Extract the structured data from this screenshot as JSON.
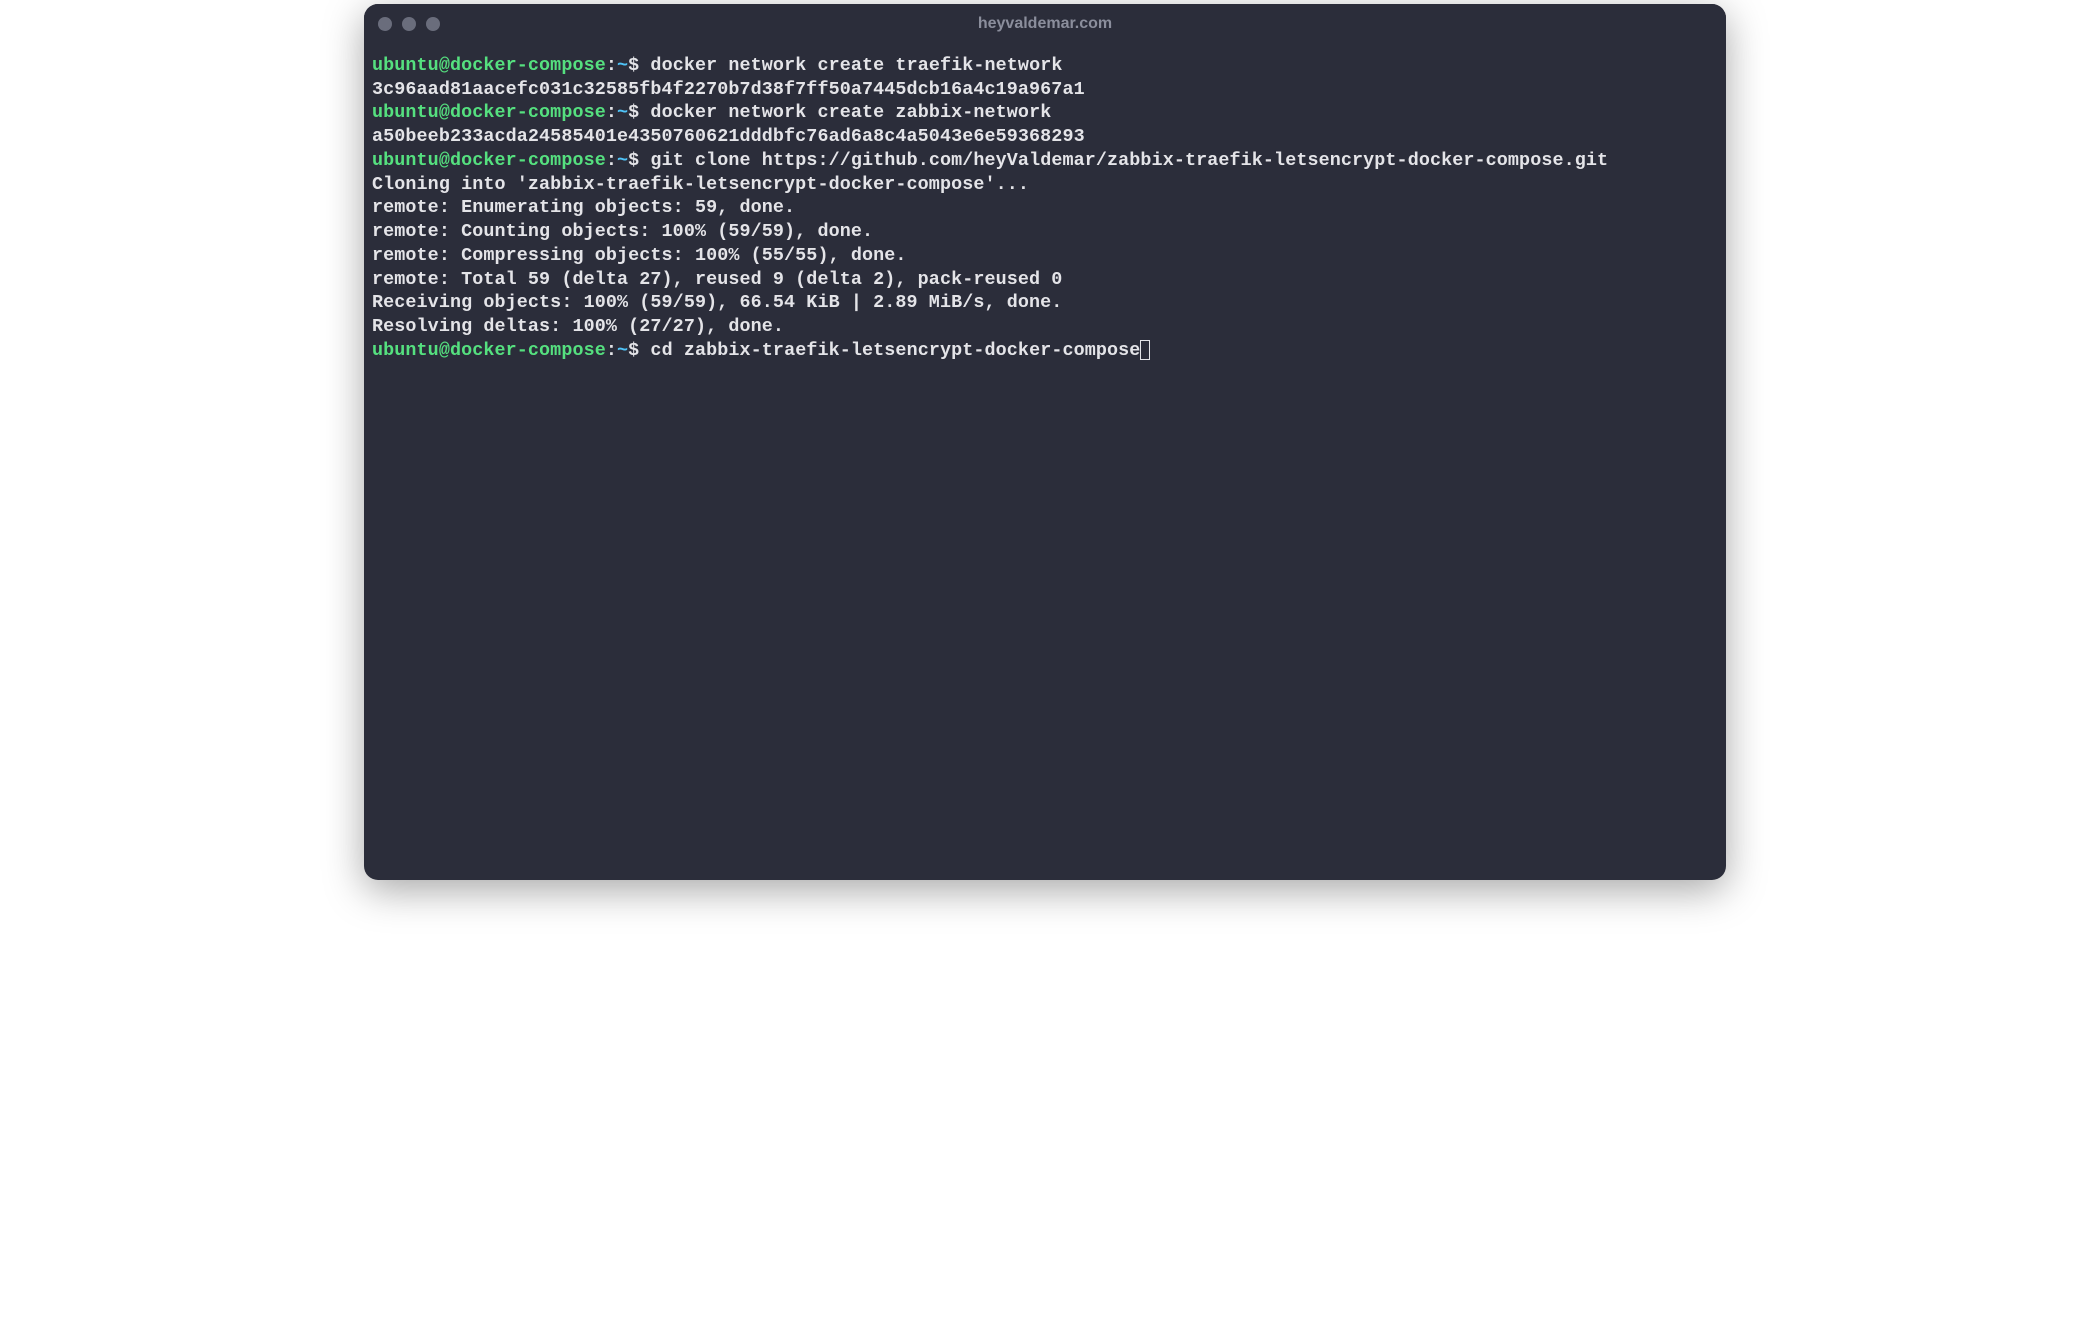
{
  "window": {
    "title": "heyvaldemar.com"
  },
  "prompt": {
    "user_host": "ubuntu@docker-compose",
    "colon": ":",
    "tilde": "~",
    "dollar": "$"
  },
  "lines": {
    "cmd1": " docker network create traefik-network",
    "out1": "3c96aad81aacefc031c32585fb4f2270b7d38f7ff50a7445dcb16a4c19a967a1",
    "cmd2": " docker network create zabbix-network",
    "out2": "a50beeb233acda24585401e4350760621dddbfc76ad6a8c4a5043e6e59368293",
    "cmd3": " git clone https://github.com/heyValdemar/zabbix-traefik-letsencrypt-docker-compose.git",
    "out3": "Cloning into 'zabbix-traefik-letsencrypt-docker-compose'...",
    "out4": "remote: Enumerating objects: 59, done.",
    "out5": "remote: Counting objects: 100% (59/59), done.",
    "out6": "remote: Compressing objects: 100% (55/55), done.",
    "out7": "remote: Total 59 (delta 27), reused 9 (delta 2), pack-reused 0",
    "out8": "Receiving objects: 100% (59/59), 66.54 KiB | 2.89 MiB/s, done.",
    "out9": "Resolving deltas: 100% (27/27), done.",
    "cmd4": " cd zabbix-traefik-letsencrypt-docker-compose"
  }
}
